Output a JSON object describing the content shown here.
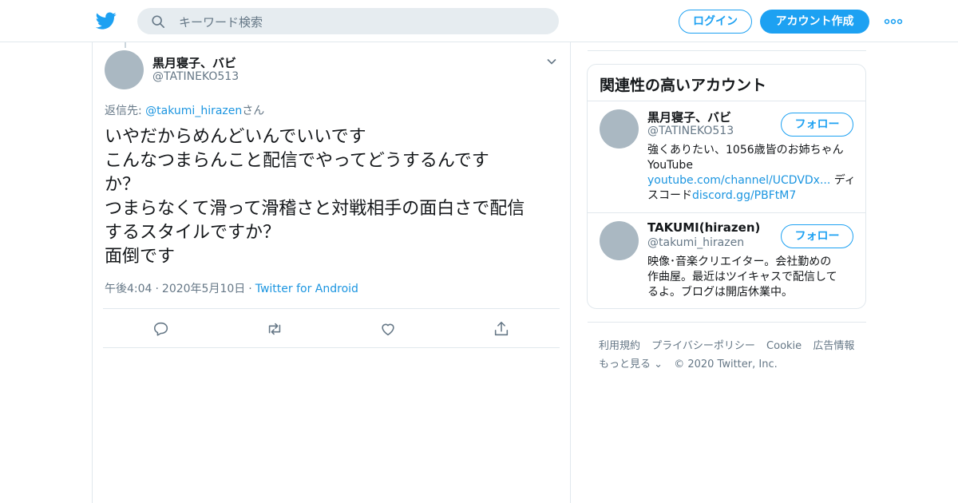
{
  "header": {
    "search_placeholder": "キーワード検索",
    "login_label": "ログイン",
    "signup_label": "アカウント作成",
    "accent": "#1da1f2"
  },
  "tweet": {
    "author_name": "黒月寝子、バビ",
    "author_handle": "@TATINEKO513",
    "reply_prefix": "返信先: ",
    "reply_to": "@takumi_hirazen",
    "reply_suffix": "さん",
    "lines": [
      "いやだからめんどいんでいいです",
      "こんなつまらんこと配信でやってどうするんです",
      "か？",
      "つまらなくて滑って滑稽さと対戦相手の面白さで配信",
      "するスタイルですか？",
      "面倒です"
    ],
    "time": "午後4:04",
    "date": "2020年5月10日",
    "source": "Twitter for Android",
    "separator": "·"
  },
  "sidebar": {
    "title": "関連性の高いアカウント",
    "follow_label": "フォロー",
    "accounts": [
      {
        "name": "黒月寝子、バビ",
        "handle": "@TATINEKO513",
        "bio_line1": "強くありたい、1056歳皆のお姉ちゃん",
        "bio_line2": "YouTube",
        "bio_link1": "youtube.com/channel/UCDVDx...",
        "bio_text3": " ディ",
        "bio_text4": "スコード",
        "bio_link2": "discord.gg/PBFtM7"
      },
      {
        "name": "TAKUMI(hirazen)",
        "handle": "@takumi_hirazen",
        "bio_line1": "映像･音楽クリエイター。会社勤めの",
        "bio_line2": "作曲屋。最近はツイキャスで配信して",
        "bio_line3": "るよ。ブログは開店休業中。"
      }
    ]
  },
  "footer": {
    "links": [
      "利用規約",
      "プライバシーポリシー",
      "Cookie",
      "広告情報"
    ],
    "more_label": "もっと見る",
    "copyright": "© 2020 Twitter, Inc."
  }
}
